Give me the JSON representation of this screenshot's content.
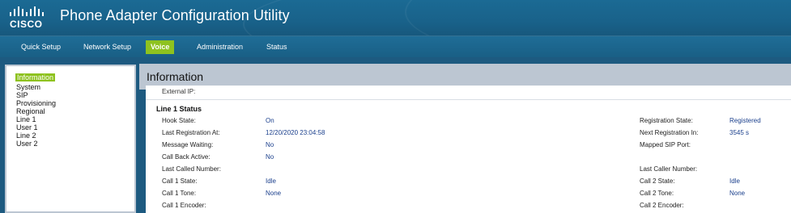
{
  "app": {
    "brand": "CISCO",
    "title": "Phone Adapter Configuration Utility"
  },
  "nav": {
    "tabs": [
      {
        "label": "Quick Setup"
      },
      {
        "label": "Network Setup"
      },
      {
        "label": "Voice",
        "active": true
      },
      {
        "label": "Administration"
      },
      {
        "label": "Status"
      }
    ]
  },
  "sidebar": {
    "items": [
      {
        "label": "Information",
        "active": true
      },
      {
        "label": "System"
      },
      {
        "label": "SIP"
      },
      {
        "label": "Provisioning"
      },
      {
        "label": "Regional"
      },
      {
        "label": "Line 1"
      },
      {
        "label": "User 1"
      },
      {
        "label": "Line 2"
      },
      {
        "label": "User 2"
      }
    ]
  },
  "main": {
    "title": "Information",
    "cut_label": "External IP:",
    "section_title": "Line 1 Status",
    "left_rows": [
      {
        "label": "Hook State:",
        "value": "On"
      },
      {
        "label": "Last Registration At:",
        "value": "12/20/2020 23:04:58"
      },
      {
        "label": "Message Waiting:",
        "value": "No"
      },
      {
        "label": "Call Back Active:",
        "value": "No"
      },
      {
        "label": "Last Called Number:",
        "value": ""
      },
      {
        "label": "Call 1 State:",
        "value": "Idle"
      },
      {
        "label": "Call 1 Tone:",
        "value": "None"
      },
      {
        "label": "Call 1 Encoder:",
        "value": ""
      }
    ],
    "right_rows": [
      {
        "label": "Registration State:",
        "value": "Registered"
      },
      {
        "label": "Next Registration In:",
        "value": "3545 s"
      },
      {
        "label": "Mapped SIP Port:",
        "value": ""
      },
      {
        "label": "",
        "value": ""
      },
      {
        "label": "Last Caller Number:",
        "value": ""
      },
      {
        "label": "Call 2 State:",
        "value": "Idle"
      },
      {
        "label": "Call 2 Tone:",
        "value": "None"
      },
      {
        "label": "Call 2 Encoder:",
        "value": ""
      }
    ]
  },
  "colors": {
    "header_blue": "#1b6a94",
    "active_green": "#8ec21f",
    "value_blue": "#1a3f8c",
    "panel_gray": "#bcc6d2"
  }
}
